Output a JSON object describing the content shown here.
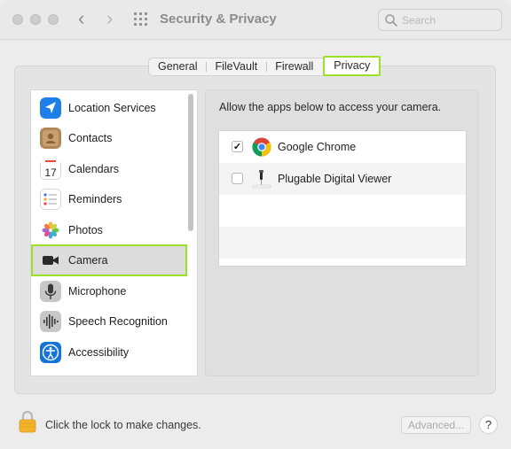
{
  "window": {
    "title": "Security & Privacy",
    "search_placeholder": "Search",
    "nav_back_glyph": "‹",
    "nav_forward_glyph": "›"
  },
  "tabs": [
    {
      "label": "General",
      "active": false
    },
    {
      "label": "FileVault",
      "active": false
    },
    {
      "label": "Firewall",
      "active": false
    },
    {
      "label": "Privacy",
      "active": true
    }
  ],
  "sidebar": {
    "items": [
      {
        "label": "Location Services",
        "icon": "location-arrow-icon",
        "selected": false
      },
      {
        "label": "Contacts",
        "icon": "contacts-book-icon",
        "selected": false
      },
      {
        "label": "Calendars",
        "icon": "calendar-icon",
        "selected": false,
        "icon_day": "17"
      },
      {
        "label": "Reminders",
        "icon": "reminders-list-icon",
        "selected": false
      },
      {
        "label": "Photos",
        "icon": "photos-flower-icon",
        "selected": false
      },
      {
        "label": "Camera",
        "icon": "video-camera-icon",
        "selected": true
      },
      {
        "label": "Microphone",
        "icon": "microphone-icon",
        "selected": false
      },
      {
        "label": "Speech Recognition",
        "icon": "waveform-icon",
        "selected": false
      },
      {
        "label": "Accessibility",
        "icon": "accessibility-icon",
        "selected": false
      }
    ]
  },
  "main": {
    "heading": "Allow the apps below to access your camera.",
    "apps": [
      {
        "name": "Google Chrome",
        "checked": true,
        "icon": "chrome-icon",
        "check_glyph": "✓"
      },
      {
        "name": "Plugable Digital Viewer",
        "checked": false,
        "icon": "microscope-icon",
        "check_glyph": ""
      }
    ]
  },
  "footer": {
    "lock_text": "Click the lock to make changes.",
    "advanced_label": "Advanced...",
    "help_label": "?"
  },
  "colors": {
    "highlight": "#9ae227",
    "location_blue": "#1f7fe8",
    "accessibility_blue": "#1273d8"
  }
}
